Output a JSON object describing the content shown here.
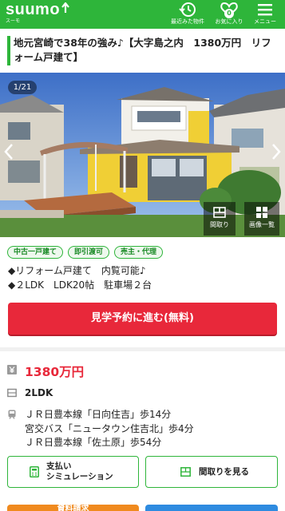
{
  "header": {
    "brand": "suumo",
    "brand_sub": "スーモ",
    "recent_label": "最近みた物件",
    "favorites_label": "お気に入り",
    "favorites_count": "0",
    "menu_label": "メニュー",
    "colors": {
      "brand_green": "#2eb53a",
      "accent_red": "#e8283a"
    }
  },
  "listing": {
    "title": "地元宮崎で38年の強み♪【大字島之内　1380万円　リフォーム戸建て】",
    "photo_counter": "1/21",
    "photo_buttons": [
      {
        "label": "間取り",
        "icon": "floorplan-icon"
      },
      {
        "label": "画像一覧",
        "icon": "grid-icon"
      }
    ],
    "tags": [
      "中古一戸建て",
      "即引渡可",
      "売主・代理"
    ],
    "features": [
      "◆リフォーム戸建て　内覧可能♪",
      "◆２LDK　LDK20帖　駐車場２台"
    ],
    "cta_label": "見学予約に進む(無料)",
    "price": "1380万円",
    "layout": "2LDK",
    "access": [
      "ＪＲ日豊本線「日向住吉」歩14分",
      "宮交バス「ニュータウン住吉北」歩4分",
      "ＪＲ日豊本線「佐土原」歩54分"
    ],
    "sub_buttons": {
      "simulation_label_line1": "支払い",
      "simulation_label_line2": "シミュレーション",
      "floorplan_label": "間取りを見る"
    },
    "bottom_buttons": [
      "資料請求",
      ""
    ]
  }
}
